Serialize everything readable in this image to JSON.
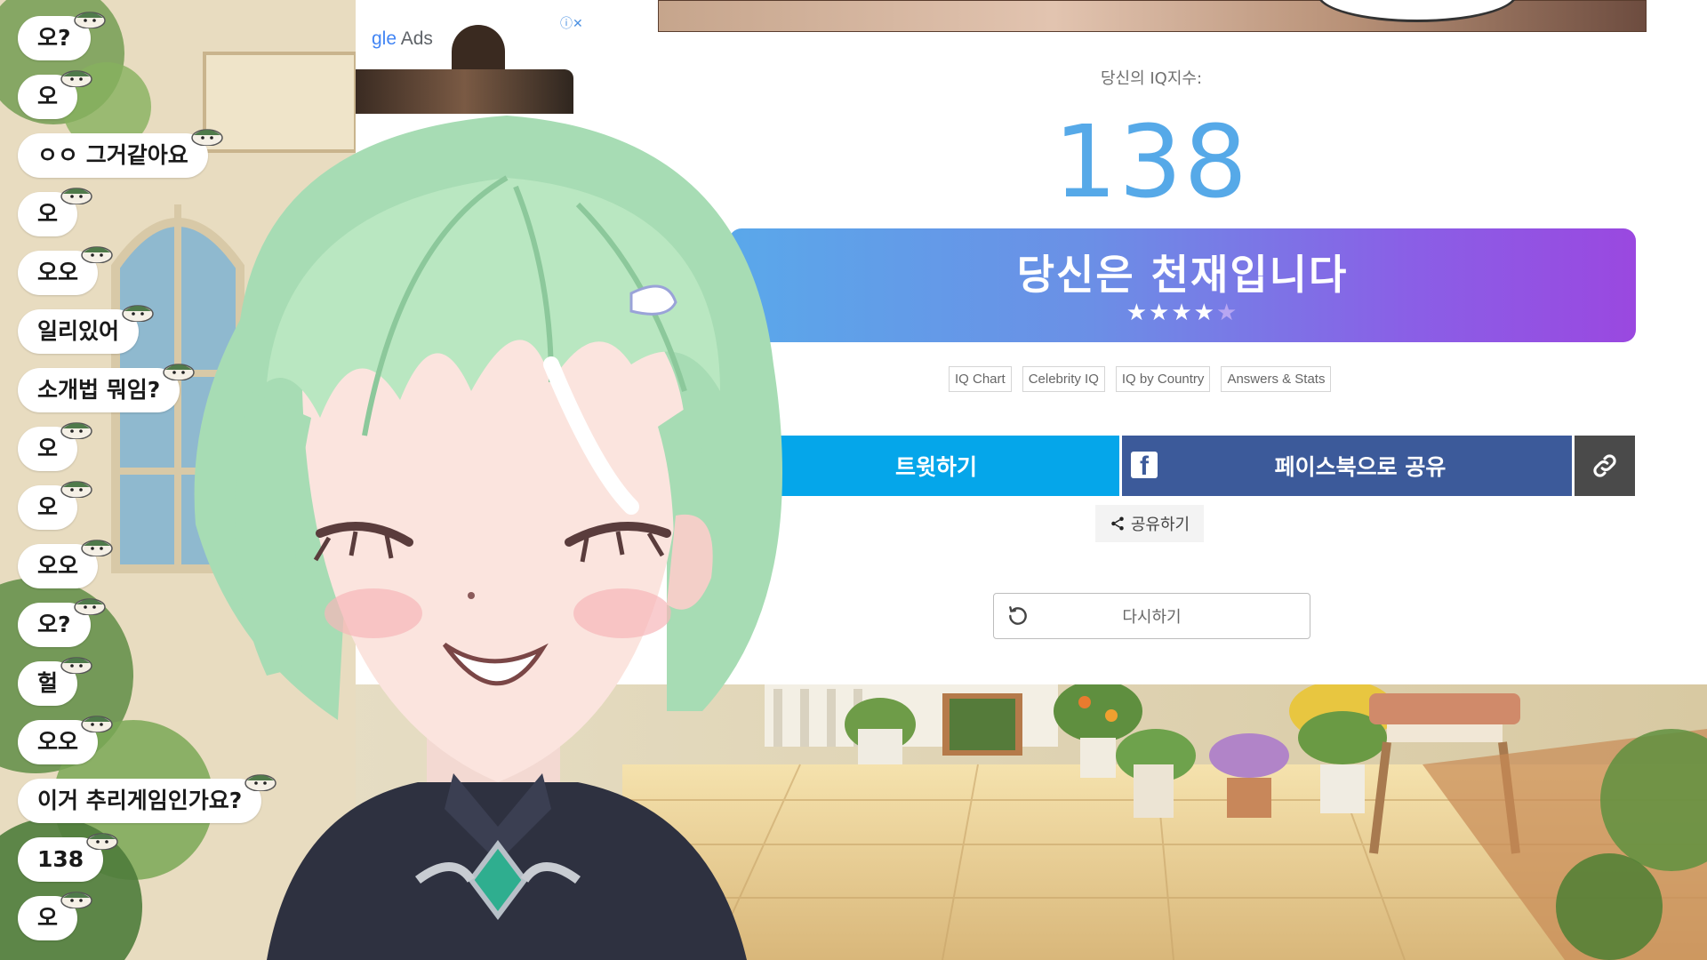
{
  "chat": {
    "messages": [
      {
        "text": "오?"
      },
      {
        "text": "오"
      },
      {
        "text": "ㅇㅇ 그거같아요"
      },
      {
        "text": "오"
      },
      {
        "text": "오오"
      },
      {
        "text": "일리있어"
      },
      {
        "text": "소개법 뭐임?"
      },
      {
        "text": "오"
      },
      {
        "text": "오"
      },
      {
        "text": "오오"
      },
      {
        "text": "오?"
      },
      {
        "text": "헐"
      },
      {
        "text": "오오"
      },
      {
        "text": "이거 추리게임인가요?"
      },
      {
        "text": "138"
      },
      {
        "text": "오"
      }
    ]
  },
  "ad": {
    "label_prefix": "gle",
    "label": "Ads",
    "info_icon": "info-close-icon"
  },
  "result": {
    "iq_label": "당신의 IQ지수:",
    "iq_value": "138",
    "title": "당신은 천재입니다",
    "stars_filled": "★★★★",
    "stars_empty": "★",
    "rating": 4,
    "rating_max": 5
  },
  "links": [
    "IQ Chart",
    "Celebrity IQ",
    "IQ by Country",
    "Answers & Stats"
  ],
  "share": {
    "tweet_label": "트윗하기",
    "facebook_label": "페이스북으로 공유",
    "link_icon": "link-icon",
    "share_label": "공유하기",
    "retry_label": "다시하기"
  },
  "colors": {
    "iq_value": "#56a9e8",
    "banner_start": "#5aa8ea",
    "banner_end": "#9a48e0",
    "tweet": "#05a6ea",
    "facebook": "#3c5a9a",
    "link_button": "#4a4a4a"
  }
}
